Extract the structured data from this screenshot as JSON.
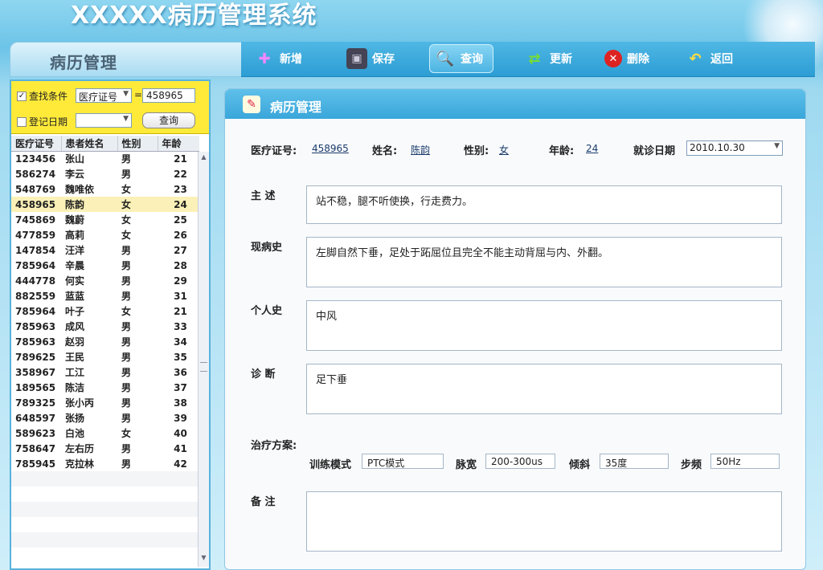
{
  "app": {
    "title": "XXXXX病历管理系统"
  },
  "module": {
    "title": "病历管理"
  },
  "toolbar": {
    "new_label": "新增",
    "save_label": "保存",
    "query_label": "查询",
    "update_label": "更新",
    "delete_label": "删除",
    "back_label": "返回"
  },
  "search": {
    "condition_label": "查找条件",
    "condition_field": "医疗证号",
    "equals": "=",
    "condition_value": "458965",
    "date_label": "登记日期",
    "date_value": "",
    "query_button": "查询"
  },
  "patients": {
    "columns": [
      "医疗证号",
      "患者姓名",
      "性别",
      "年龄"
    ],
    "selected_id": "458965",
    "rows": [
      [
        "123456",
        "张山",
        "男",
        "21"
      ],
      [
        "586274",
        "李云",
        "男",
        "22"
      ],
      [
        "548769",
        "魏唯依",
        "女",
        "23"
      ],
      [
        "458965",
        "陈韵",
        "女",
        "24"
      ],
      [
        "745869",
        "魏蔚",
        "女",
        "25"
      ],
      [
        "477859",
        "高莉",
        "女",
        "26"
      ],
      [
        "147854",
        "汪洋",
        "男",
        "27"
      ],
      [
        "785964",
        "辛晨",
        "男",
        "28"
      ],
      [
        "444778",
        "何实",
        "男",
        "29"
      ],
      [
        "882559",
        "蓝蓝",
        "男",
        "31"
      ],
      [
        "785964",
        "叶子",
        "女",
        "21"
      ],
      [
        "785963",
        "成风",
        "男",
        "33"
      ],
      [
        "785963",
        "赵羽",
        "男",
        "34"
      ],
      [
        "789625",
        "王民",
        "男",
        "35"
      ],
      [
        "358967",
        "工江",
        "男",
        "36"
      ],
      [
        "189565",
        "陈洁",
        "男",
        "37"
      ],
      [
        "789325",
        "张小丙",
        "男",
        "38"
      ],
      [
        "648597",
        "张扬",
        "男",
        "39"
      ],
      [
        "589623",
        "白池",
        "女",
        "40"
      ],
      [
        "758647",
        "左右历",
        "男",
        "41"
      ],
      [
        "785945",
        "克拉林",
        "男",
        "42"
      ]
    ]
  },
  "record": {
    "panel_title": "病历管理",
    "id_label": "医疗证号:",
    "id_value": "458965",
    "name_label": "姓名:",
    "name_value": "陈韵",
    "gender_label": "性别:",
    "gender_value": "女",
    "age_label": "年龄:",
    "age_value": "24",
    "date_label": "就诊日期",
    "date_value": "2010.10.30",
    "complaint_label": "主 述",
    "complaint_value": "站不稳，腿不听使换，行走费力。",
    "history_label": "现病史",
    "history_value": "左脚自然下垂，足处于跖屈位且完全不能主动背屈与内、外翻。",
    "personal_label": "个人史",
    "personal_value": "中风",
    "diagnosis_label": "诊 断",
    "diagnosis_value": "足下垂",
    "plan_label": "治疗方案:",
    "mode_label": "训练模式",
    "mode_value": "PTC模式",
    "pulse_label": "脉宽",
    "pulse_value": "200-300us",
    "tilt_label": "倾斜",
    "tilt_value": "35度",
    "freq_label": "步频",
    "freq_value": "50Hz",
    "notes_label": "备 注",
    "notes_value": ""
  },
  "colors": {
    "accent": "#39a6da",
    "search_bg": "#ffea3a",
    "selected_row": "#fbf1b8"
  }
}
